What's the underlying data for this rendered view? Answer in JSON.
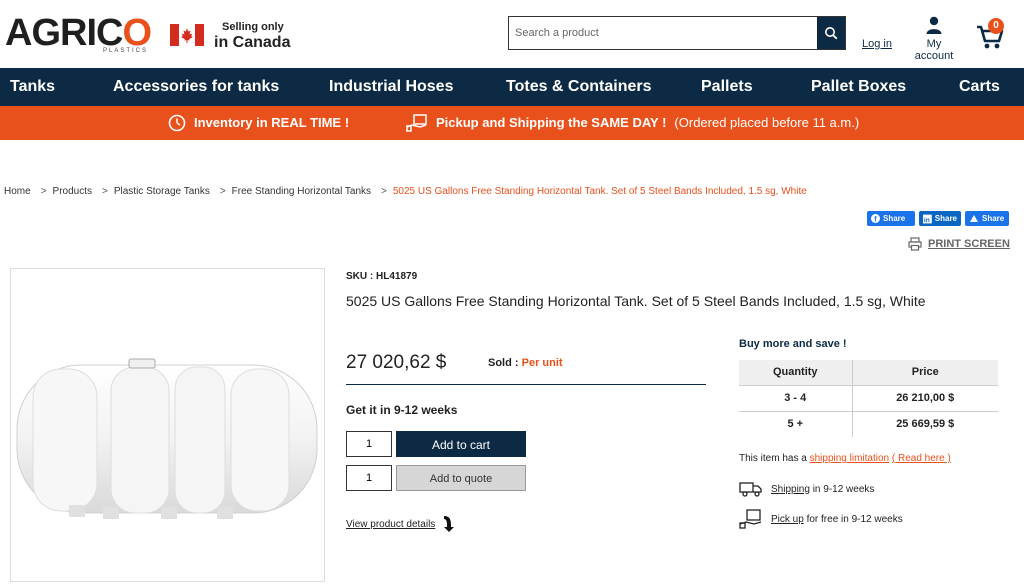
{
  "brand": {
    "logo_text": "AGRICO",
    "logo_sub": "PLASTICS",
    "selling_small": "Selling only",
    "selling_big": "in Canada",
    "accent": "#e8501c",
    "navy": "#0d2a44"
  },
  "header": {
    "search_placeholder": "Search a product",
    "login": "Log in",
    "account": "My account",
    "cart_count": "0"
  },
  "nav": {
    "items": [
      "Tanks",
      "Accessories for tanks",
      "Industrial Hoses",
      "Totes & Containers",
      "Pallets",
      "Pallet Boxes",
      "Carts"
    ]
  },
  "promo": {
    "inventory": "Inventory in REAL TIME !",
    "pickup_bold": "Pickup and Shipping the SAME DAY !",
    "pickup_note": "(Ordered placed before 11 a.m.)"
  },
  "breadcrumb": {
    "items": [
      "Home",
      "Products",
      "Plastic Storage Tanks",
      "Free Standing Horizontal Tanks"
    ],
    "current": "5025 US Gallons Free Standing Horizontal Tank. Set of 5 Steel Bands Included, 1.5 sg, White"
  },
  "share": {
    "facebook": "Share",
    "linkedin": "Share",
    "other": "Share",
    "print": "PRINT SCREEN"
  },
  "product": {
    "sku_label": "SKU :",
    "sku": "HL41879",
    "title": "5025 US Gallons Free Standing Horizontal Tank. Set of 5 Steel Bands Included, 1.5 sg, White",
    "price": "27 020,62 $",
    "sold_label": "Sold :",
    "sold_value": "Per unit",
    "delivery": "Get it in 9-12 weeks",
    "qty_cart": "1",
    "qty_quote": "1",
    "add_to_cart": "Add to cart",
    "add_to_quote": "Add to quote",
    "view_details": "View product details"
  },
  "buy_more": {
    "title": "Buy more and save !",
    "headers": [
      "Quantity",
      "Price"
    ],
    "rows": [
      {
        "qty": "3 - 4",
        "price": "26 210,00 $"
      },
      {
        "qty": "5 +",
        "price": "25 669,59 $"
      }
    ]
  },
  "shipping": {
    "limit_text": "This item has a",
    "limit_link": "shipping limitation",
    "read_here": "( Read here )",
    "ship_link": "Shipping",
    "ship_text": "in 9-12 weeks",
    "pickup_link": "Pick up",
    "pickup_text": "for free in 9-12 weeks"
  }
}
